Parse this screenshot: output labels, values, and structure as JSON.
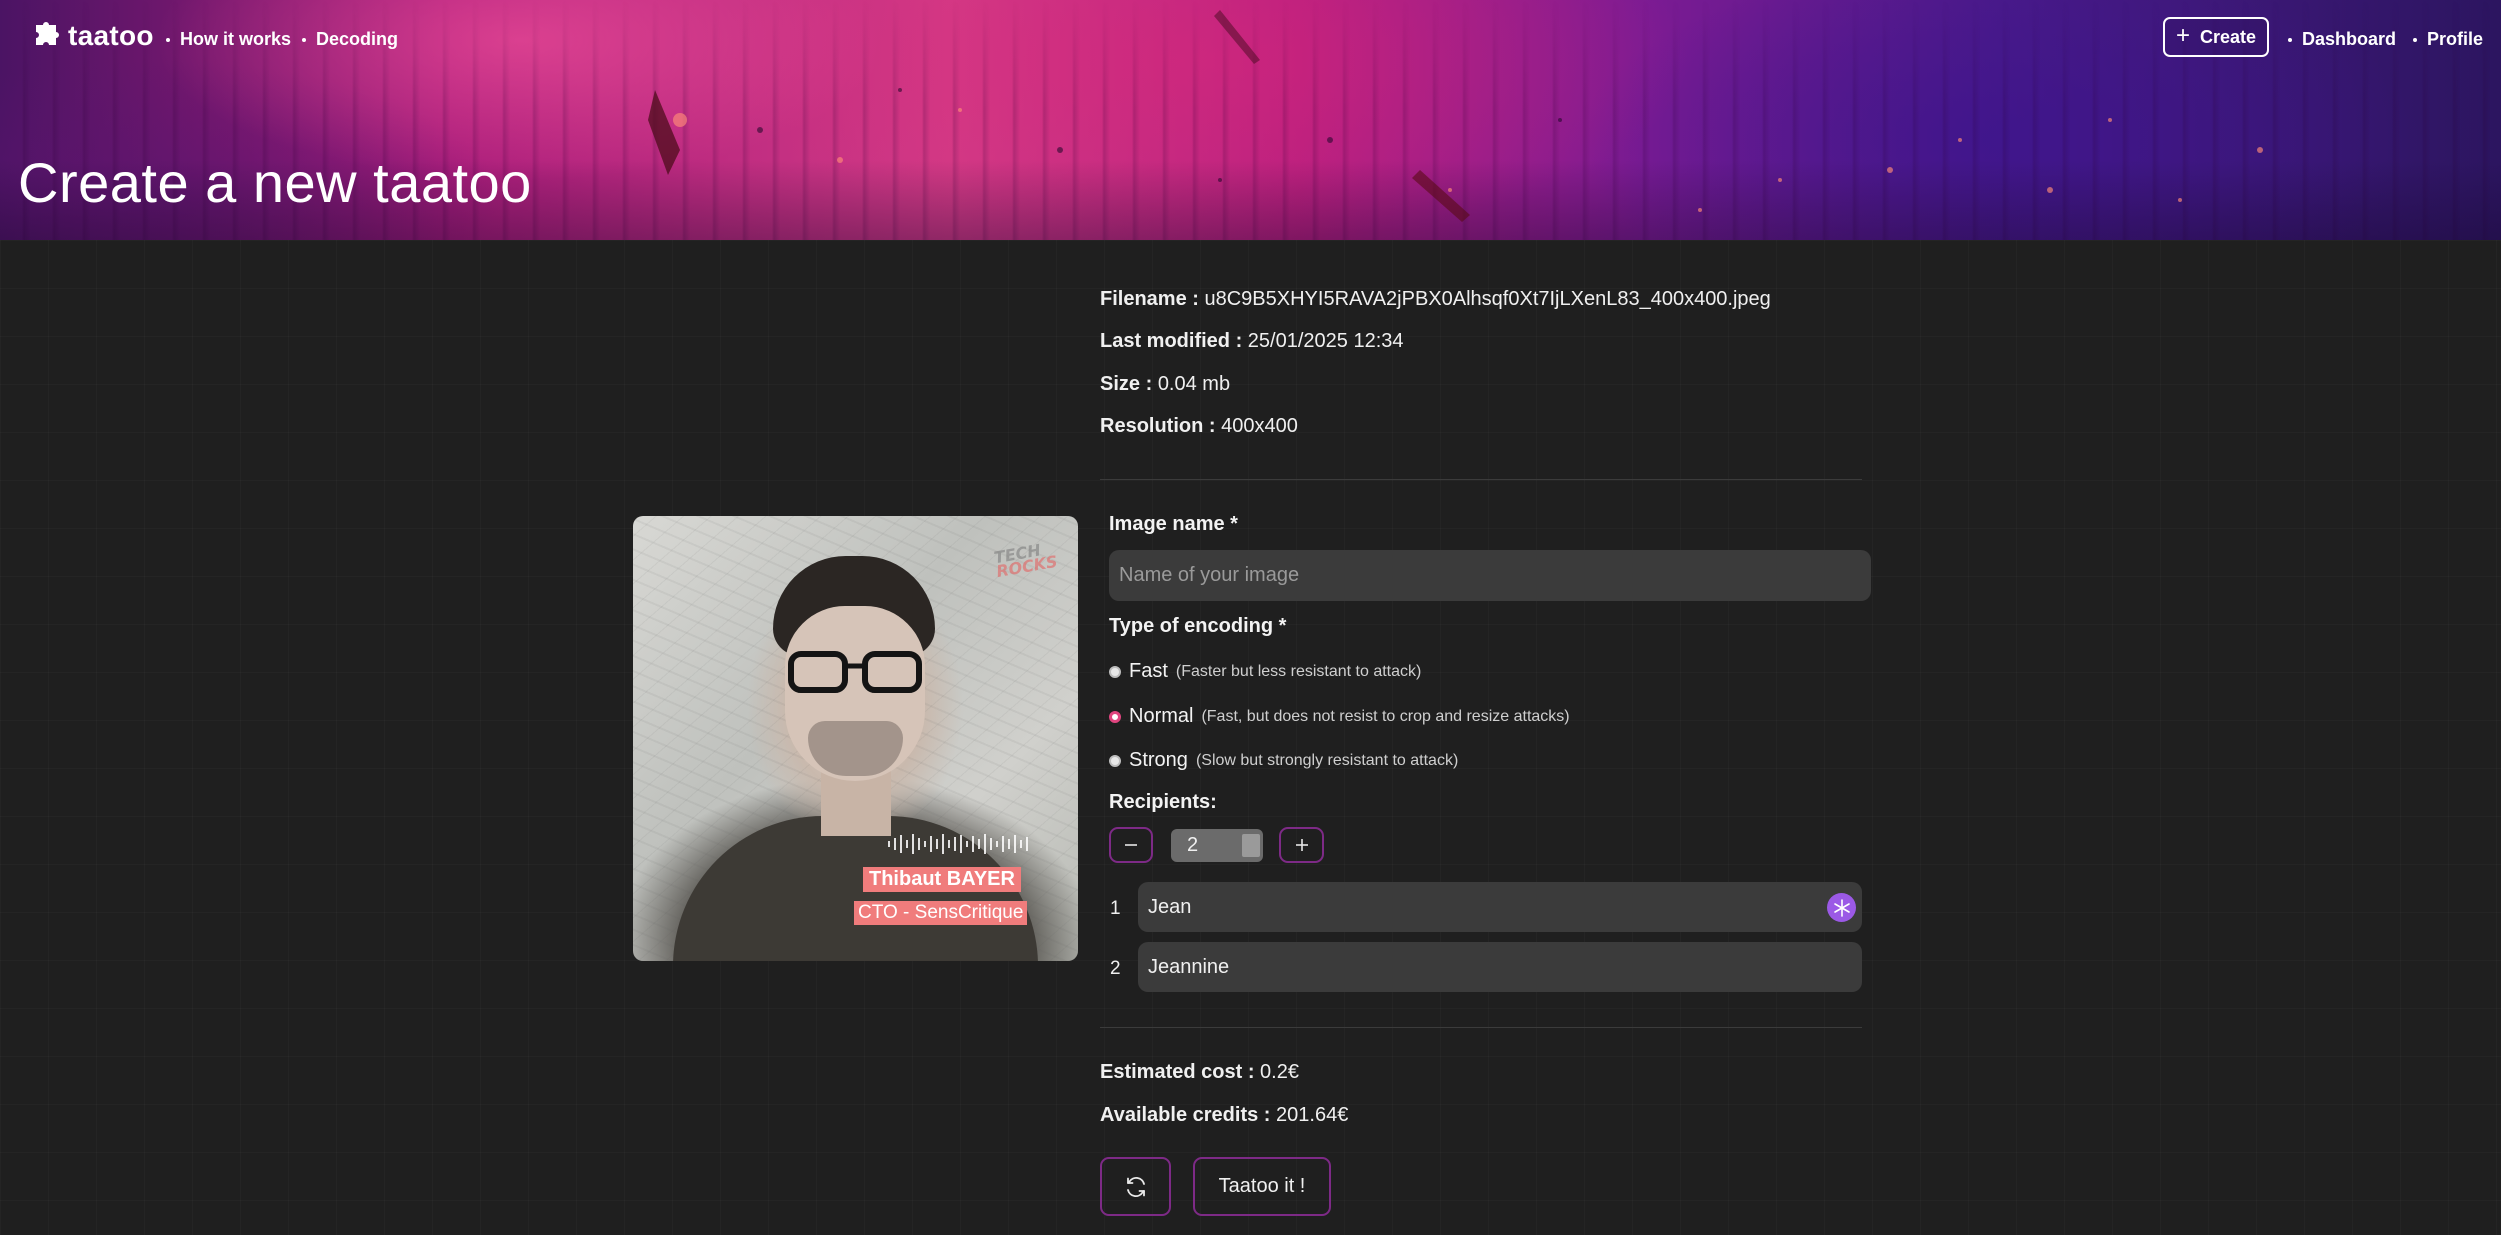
{
  "nav": {
    "logo_text": "taatoo",
    "links": [
      "How it works",
      "Decoding"
    ],
    "create_label": "Create",
    "right_links": [
      "Dashboard",
      "Profile"
    ]
  },
  "hero": {
    "title": "Create a new taatoo"
  },
  "file_info": {
    "filename_label": "Filename :",
    "filename": "u8C9B5XHYI5RAVA2jPBX0Alhsqf0Xt7IjLXenL83_400x400.jpeg",
    "modified_label": "Last modified :",
    "modified": "25/01/2025 12:34",
    "size_label": "Size :",
    "size": "0.04 mb",
    "resolution_label": "Resolution :",
    "resolution": "400x400"
  },
  "preview": {
    "name_tag": "Thibaut BAYER",
    "role_tag": "CTO - SensCritique",
    "brand_line1": "TECH",
    "brand_line2": "ROCKS"
  },
  "form": {
    "image_name_label": "Image name *",
    "image_name_placeholder": "Name of your image",
    "image_name_value": "",
    "encoding_label": "Type of encoding *",
    "encoding_options": [
      {
        "label": "Fast",
        "hint": "(Faster but less resistant to attack)",
        "checked": false
      },
      {
        "label": "Normal",
        "hint": "(Fast, but does not resist to crop and resize attacks)",
        "checked": true
      },
      {
        "label": "Strong",
        "hint": "(Slow but strongly resistant to attack)",
        "checked": false
      }
    ],
    "recipients_label": "Recipients:",
    "recipients_count": "2",
    "recipients": [
      {
        "index": "1",
        "name": "Jean"
      },
      {
        "index": "2",
        "name": "Jeannine"
      }
    ]
  },
  "summary": {
    "cost_label": "Estimated cost :",
    "cost": "0.2€",
    "credits_label": "Available credits :",
    "credits": "201.64€",
    "submit_label": "Taatoo it !"
  },
  "colors": {
    "accent_border": "#7d2a86",
    "radio_checked": "#e0457f",
    "badge": "#9b59e6",
    "tag": "#f07c7c"
  }
}
